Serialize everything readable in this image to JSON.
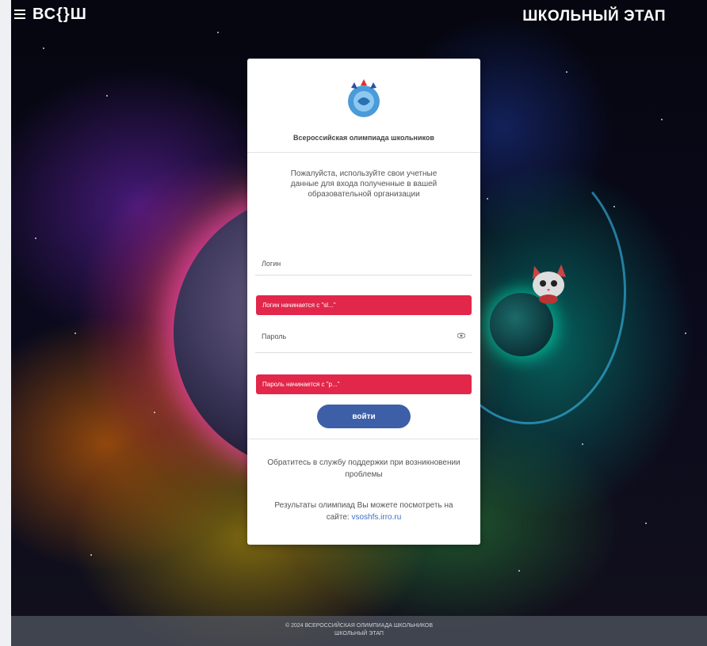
{
  "header": {
    "logo": "ВС{}Ш",
    "stage_title": "ШКОЛЬНЫЙ ЭТАП"
  },
  "card": {
    "org_name": "Всероссийская олимпиада школьников",
    "instruction": "Пожалуйста, используйте свои учетные данные для входа полученные в вашей образовательной организации",
    "login_label": "Логин",
    "login_hint": "Логин начинается с \"sl...\"",
    "password_label": "Пароль",
    "password_hint": "Пароль начинается с \"p...\"",
    "submit_label": "войти",
    "support_text": "Обратитесь в службу поддержки при возникновении проблемы",
    "results_text": "Результаты олимпиад Вы можете посмотреть на сайте:",
    "results_link": "vsoshfs.irro.ru"
  },
  "footer": {
    "line1": "© 2024 ВСЕРОССИЙСКАЯ ОЛИМПИАДА ШКОЛЬНИКОВ",
    "line2": "ШКОЛЬНЫЙ ЭТАП"
  },
  "colors": {
    "accent": "#3d5fa8",
    "hint_bg": "#e2274a"
  }
}
